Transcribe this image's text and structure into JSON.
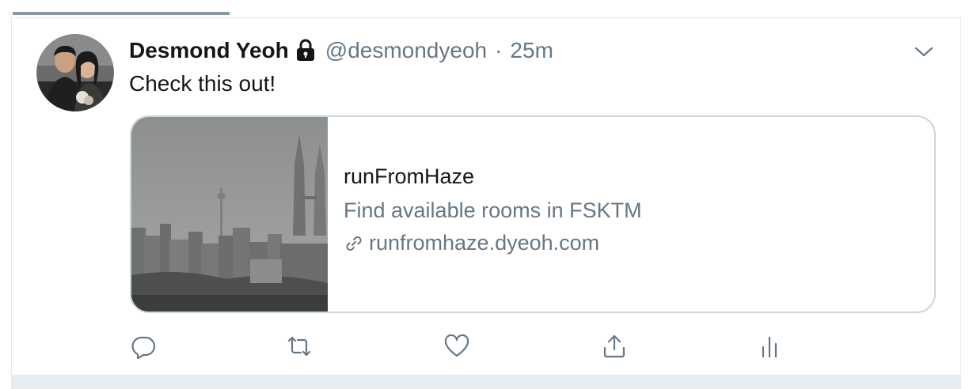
{
  "tweet": {
    "display_name": "Desmond Yeoh",
    "handle": "@desmondyeoh",
    "separator": "·",
    "time": "25m",
    "text": "Check this out!",
    "avatar_alt": "Desmond Yeoh",
    "card": {
      "title": "runFromHaze",
      "description": "Find available rooms in FSKTM",
      "domain": "runfromhaze.dyeoh.com",
      "image_alt": "Hazy city skyline with twin towers"
    }
  },
  "icons": {
    "lock": "lock-icon",
    "caret": "chevron-down-icon",
    "link": "link-icon",
    "reply": "reply-icon",
    "retweet": "retweet-icon",
    "like": "heart-icon",
    "share": "share-icon",
    "analytics": "analytics-icon"
  },
  "colors": {
    "text": "#14171a",
    "secondary": "#657786",
    "border": "#ccd6dd",
    "tab_underline": "#8899a6"
  }
}
